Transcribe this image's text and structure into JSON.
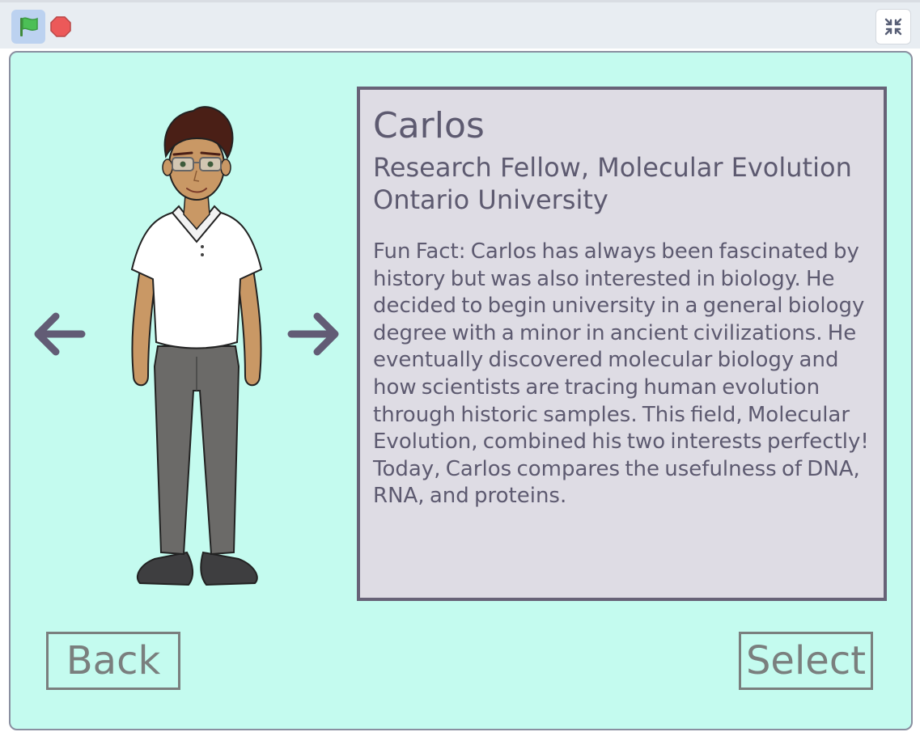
{
  "toolbar": {
    "flag_icon": "green-flag-icon",
    "stop_icon": "stop-icon",
    "fullscreen_icon": "exit-fullscreen-icon"
  },
  "stage": {
    "background_color": "#c4fbef",
    "navigation": {
      "prev_icon": "arrow-left-icon",
      "next_icon": "arrow-right-icon"
    },
    "profile": {
      "name": "Carlos",
      "role": "Research Fellow, Molecular Evolution",
      "institution": "Ontario University",
      "fun_fact": "Fun Fact: Carlos has always been fascinated by history but was also interested in biology. He decided to begin university in a general biology degree with a minor in ancient civilizations. He eventually discovered molecular biology and how scientists are tracing human evolution through historic samples. This field, Molecular Evolution, combined his two interests perfectly! Today, Carlos compares the usefulness of DNA, RNA, and proteins."
    },
    "buttons": {
      "back_label": "Back",
      "select_label": "Select"
    }
  }
}
